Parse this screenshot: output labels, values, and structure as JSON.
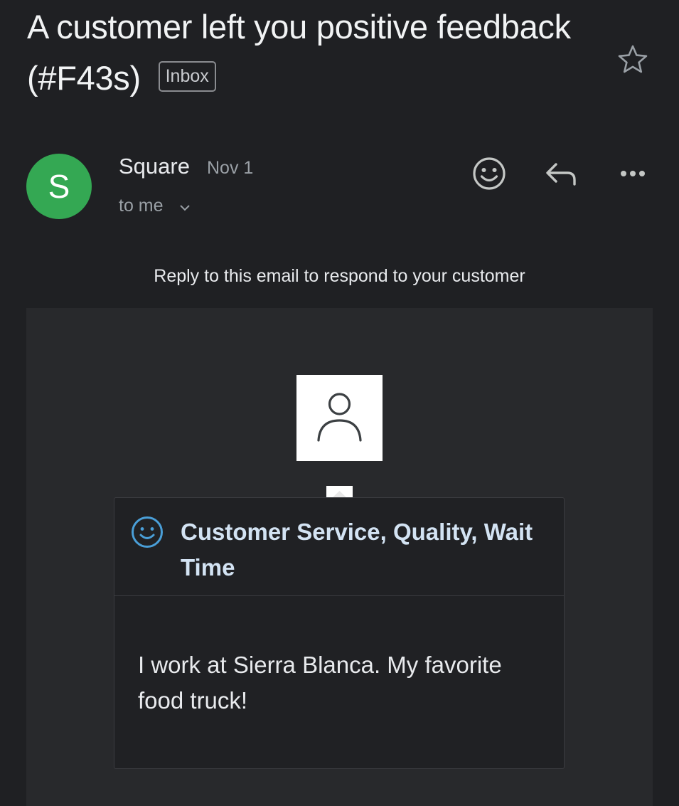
{
  "email": {
    "subject": "A customer left you positive feedback (#F43s)",
    "label_badge": "Inbox",
    "sender_initial": "S",
    "sender_name": "Square",
    "date": "Nov 1",
    "recipient": "to me",
    "avatar_color": "#34a853"
  },
  "actions": {
    "star_icon": "star-icon",
    "emoji_icon": "add-reaction-icon",
    "reply_icon": "reply-icon",
    "more_icon": "more-options-icon"
  },
  "body": {
    "instruction": "Reply to this email to respond to your customer",
    "feedback_tags": "Customer Service, Quality, Wait Time",
    "feedback_comment": "I work at Sierra Blanca. My favorite food truck!",
    "accent_color": "#4a9fd8"
  }
}
